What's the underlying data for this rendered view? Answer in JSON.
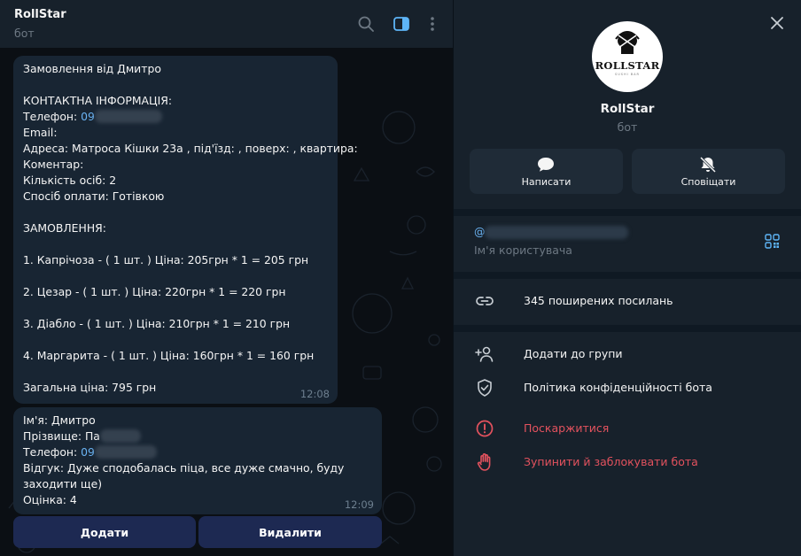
{
  "chat": {
    "title": "RollStar",
    "subtitle": "бот",
    "messages": [
      {
        "lines": [
          "Замовлення від Дмитро",
          "",
          "КОНТАКТНА ІНФОРМАЦІЯ:",
          "Телефон: ",
          "Email:",
          "Адреса: Матроса Кішки 23а , під'їзд: , поверх: , квартира:",
          "Коментар:",
          "Кількість осіб: 2",
          "Спосіб оплати: Готівкою",
          "",
          "ЗАМОВЛЕННЯ:",
          "",
          "1. Капрічоза - ( 1 шт. ) Ціна: 205грн * 1 = 205 грн",
          "",
          "2. Цезар - ( 1 шт. ) Ціна: 220грн * 1 = 220 грн",
          "",
          "3. Діабло - ( 1 шт. ) Ціна: 210грн * 1 = 210 грн",
          "",
          "4. Маргарита - ( 1 шт. ) Ціна: 160грн * 1 = 160 грн",
          "",
          "Загальна ціна: 795 грн"
        ],
        "phone_prefix": "09",
        "time": "12:08"
      },
      {
        "lines": [
          "Ім'я: Дмитро",
          "Прізвище: Па",
          "Телефон: ",
          "Відгук: Дуже сподобалась піца, все дуже смачно, буду заходити ще)",
          "Оцінка: 4"
        ],
        "phone_prefix": "09",
        "time": "12:09"
      }
    ],
    "keyboard": {
      "add_label": "Додати",
      "delete_label": "Видалити"
    }
  },
  "profile": {
    "avatar_text": "ROLLSTAR",
    "avatar_sub": "SUSHI BAR",
    "name": "RollStar",
    "subtitle": "бот",
    "actions": {
      "write_label": "Написати",
      "notify_label": "Сповіщати"
    },
    "username_prefix": "@",
    "username_caption": "Ім'я користувача",
    "links_label": "345 поширених посилань",
    "add_group_label": "Додати до групи",
    "privacy_label": "Політика конфіденційності бота",
    "report_label": "Поскаржитися",
    "block_label": "Зупинити й заблокувати бота"
  },
  "colors": {
    "accent": "#6ab3f3",
    "danger": "#e3525e",
    "bubble": "#182533",
    "panel": "#17212b",
    "keyboard_button": "#1d2952"
  },
  "icons": [
    "search-icon",
    "sidebar-toggle-icon",
    "more-vertical-icon",
    "close-icon",
    "chat-bubble-icon",
    "bell-off-icon",
    "qr-code-icon",
    "link-icon",
    "add-user-icon",
    "shield-check-icon",
    "alert-circle-icon",
    "hand-stop-icon"
  ]
}
